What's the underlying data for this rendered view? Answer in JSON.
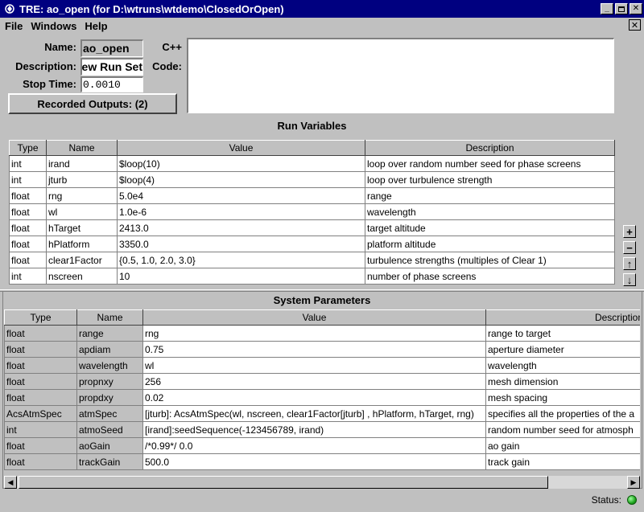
{
  "window": {
    "title": "TRE:  ao_open  (for D:\\wtruns\\wtdemo\\ClosedOrOpen)"
  },
  "menu": [
    "File",
    "Windows",
    "Help"
  ],
  "form": {
    "name_label": "Name:",
    "name_value": "ao_open",
    "description_label": "Description:",
    "description_value": "New Run Set",
    "stop_time_label": "Stop Time:",
    "stop_time_value": "0.0010",
    "recorded_outputs_label": "Recorded Outputs: (2)",
    "cpp_label": "C++",
    "code_label": "Code:",
    "code_value": ""
  },
  "run_variables": {
    "title": "Run Variables",
    "columns": [
      "Type",
      "Name",
      "Value",
      "Description"
    ],
    "rows": [
      [
        "int",
        "irand",
        "$loop(10)",
        "loop over random number seed for phase screens"
      ],
      [
        "int",
        "jturb",
        "$loop(4)",
        "loop over turbulence strength"
      ],
      [
        "float",
        "rng",
        "5.0e4",
        "range"
      ],
      [
        "float",
        "wl",
        "1.0e-6",
        "wavelength"
      ],
      [
        "float",
        "hTarget",
        "2413.0",
        "target altitude"
      ],
      [
        "float",
        "hPlatform",
        "3350.0",
        "platform altitude"
      ],
      [
        "float",
        "clear1Factor",
        "{0.5, 1.0, 2.0, 3.0}",
        "turbulence strengths (multiples of Clear 1)"
      ],
      [
        "int",
        "nscreen",
        "10",
        "number of phase screens"
      ]
    ]
  },
  "system_parameters": {
    "title": "System Parameters",
    "columns": [
      "Type",
      "Name",
      "Value",
      "Description"
    ],
    "rows": [
      [
        "float",
        "range",
        "rng",
        "range to target"
      ],
      [
        "float",
        "apdiam",
        "0.75",
        "aperture diameter"
      ],
      [
        "float",
        "wavelength",
        "wl",
        "wavelength"
      ],
      [
        "float",
        "propnxy",
        "256",
        "mesh dimension"
      ],
      [
        "float",
        "propdxy",
        "0.02",
        "mesh spacing"
      ],
      [
        "AcsAtmSpec",
        "atmSpec",
        "[jturb]: AcsAtmSpec(wl, nscreen, clear1Factor[jturb] , hPlatform, hTarget, rng)",
        "specifies all the properties of  the a"
      ],
      [
        "int",
        "atmoSeed",
        "[irand]:seedSequence(-123456789, irand)",
        "random number seed for atmosph"
      ],
      [
        "float",
        "aoGain",
        "/*0.99*/ 0.0",
        "ao gain"
      ],
      [
        "float",
        "trackGain",
        "500.0",
        "track gain"
      ]
    ]
  },
  "side_buttons": [
    "+",
    "−",
    "↑",
    "↓"
  ],
  "status": {
    "label": "Status:",
    "led_color": "#1ea41e"
  }
}
